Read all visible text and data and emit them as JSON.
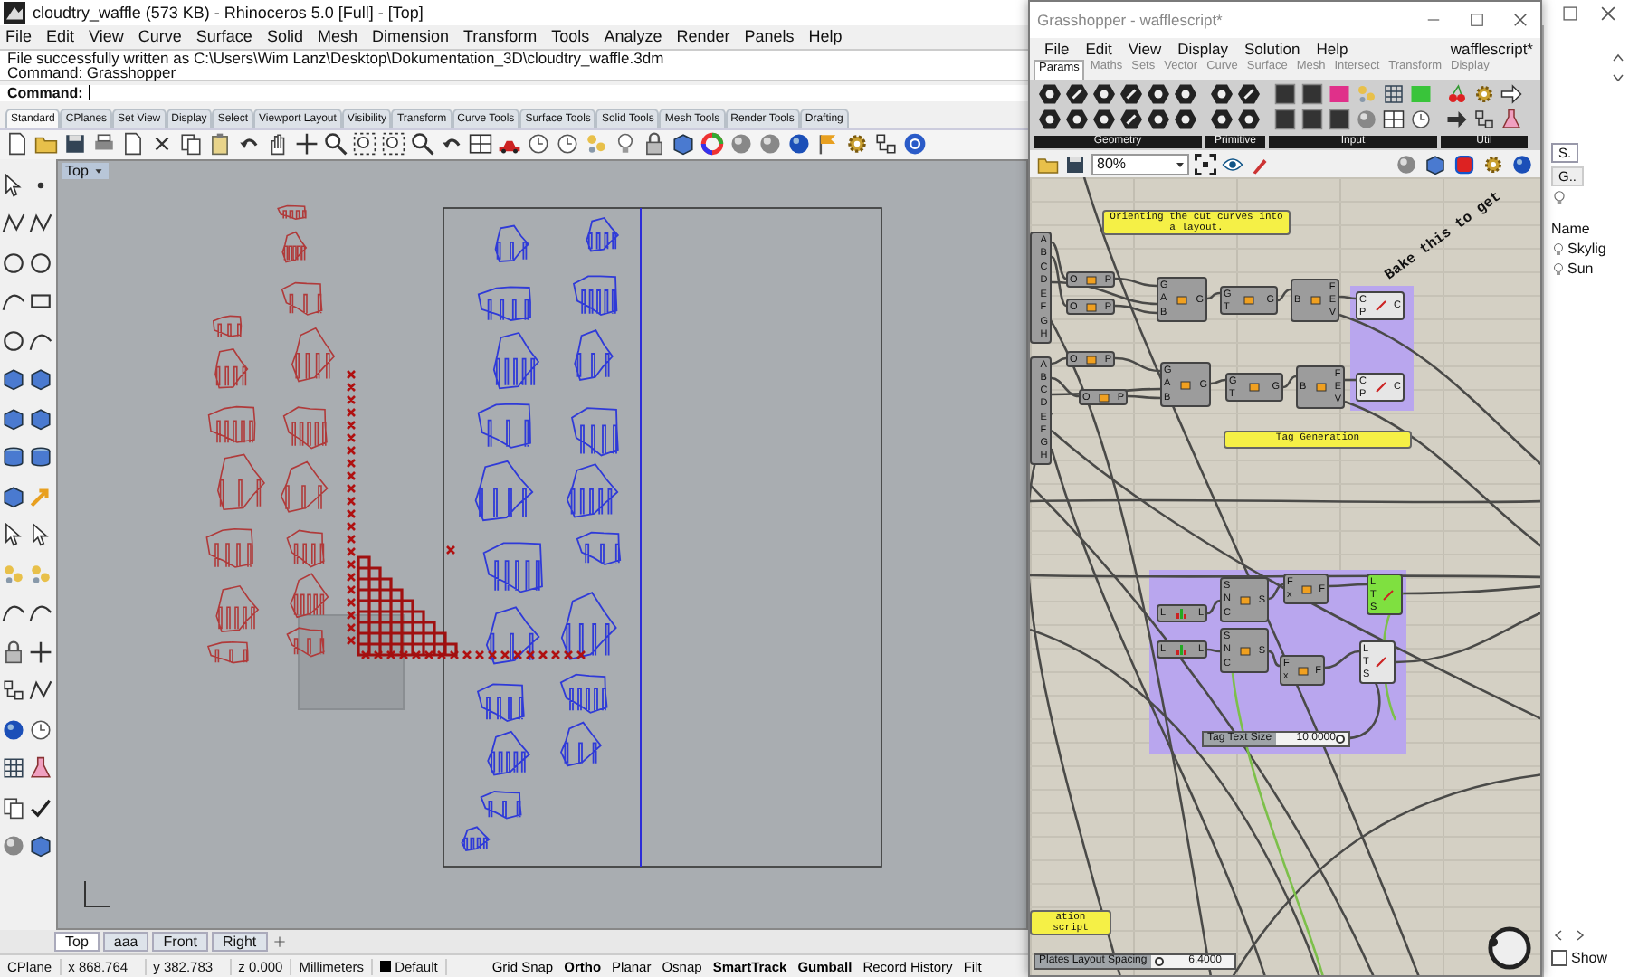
{
  "window": {
    "title": "cloudtry_waffle (573 KB) - Rhinoceros 5.0 [Full] - [Top]"
  },
  "menu": [
    "File",
    "Edit",
    "View",
    "Curve",
    "Surface",
    "Solid",
    "Mesh",
    "Dimension",
    "Transform",
    "Tools",
    "Analyze",
    "Render",
    "Panels",
    "Help"
  ],
  "command_history": [
    "File successfully written as C:\\Users\\Wim Lanz\\Desktop\\Dokumentation_3D\\cloudtry_waffle.3dm",
    "Command: Grasshopper"
  ],
  "command_prompt": "Command:",
  "toolbar_tabs": [
    {
      "label": "Standard",
      "selected": true
    },
    {
      "label": "CPlanes",
      "selected": false
    },
    {
      "label": "Set View",
      "selected": false
    },
    {
      "label": "Display",
      "selected": false
    },
    {
      "label": "Select",
      "selected": false
    },
    {
      "label": "Viewport Layout",
      "selected": false
    },
    {
      "label": "Visibility",
      "selected": false
    },
    {
      "label": "Transform",
      "selected": false
    },
    {
      "label": "Curve Tools",
      "selected": false
    },
    {
      "label": "Surface Tools",
      "selected": false
    },
    {
      "label": "Solid Tools",
      "selected": false
    },
    {
      "label": "Mesh Tools",
      "selected": false
    },
    {
      "label": "Render Tools",
      "selected": false
    },
    {
      "label": "Drafting",
      "selected": false
    }
  ],
  "viewport": {
    "label": "Top"
  },
  "viewport_tabs": [
    {
      "label": "Top",
      "selected": true
    },
    {
      "label": "aaa",
      "selected": false
    },
    {
      "label": "Front",
      "selected": false
    },
    {
      "label": "Right",
      "selected": false
    }
  ],
  "status_bar": {
    "cplane": "CPlane",
    "x": "x 868.764",
    "y": "y 382.783",
    "z": "z 0.000",
    "units": "Millimeters",
    "layer": "Default",
    "toggles": [
      {
        "label": "Grid Snap",
        "on": false
      },
      {
        "label": "Ortho",
        "on": true
      },
      {
        "label": "Planar",
        "on": false
      },
      {
        "label": "Osnap",
        "on": false
      },
      {
        "label": "SmartTrack",
        "on": true
      },
      {
        "label": "Gumball",
        "on": true
      },
      {
        "label": "Record History",
        "on": false
      },
      {
        "label": "Filt",
        "on": false
      }
    ]
  },
  "side_panel": {
    "tabs": [
      {
        "label": "S.",
        "selected": true
      },
      {
        "label": "G..",
        "selected": false
      }
    ],
    "column": "Name",
    "items": [
      "Skylig",
      "Sun"
    ],
    "show_checkbox": {
      "label": "Show",
      "checked": false
    }
  },
  "grasshopper": {
    "title": "Grasshopper - wafflescript*",
    "menu": [
      "File",
      "Edit",
      "View",
      "Display",
      "Solution",
      "Help"
    ],
    "document": "wafflescript*",
    "tabs": [
      {
        "label": "Params",
        "selected": true
      },
      {
        "label": "Maths",
        "selected": false
      },
      {
        "label": "Sets",
        "selected": false
      },
      {
        "label": "Vector",
        "selected": false
      },
      {
        "label": "Curve",
        "selected": false
      },
      {
        "label": "Surface",
        "selected": false
      },
      {
        "label": "Mesh",
        "selected": false
      },
      {
        "label": "Intersect",
        "selected": false
      },
      {
        "label": "Transform",
        "selected": false
      },
      {
        "label": "Display",
        "selected": false
      }
    ],
    "ribbon_groups": [
      "Geometry",
      "Primitive",
      "Input",
      "Util"
    ],
    "zoom": "80%",
    "canvas": {
      "panels": [
        {
          "text": "Orienting the cut curves into a layout."
        },
        {
          "text": "Tag Generation"
        },
        {
          "text": "ation script"
        }
      ],
      "note": "Bake this to get",
      "sliders": [
        {
          "label": "Tag Text Size",
          "value": "10.0000",
          "level": 0.95
        },
        {
          "label": "Plates Layout Spacing",
          "value": "6.4000",
          "level": 0.15
        }
      ],
      "nodes": [
        {
          "kind": "param",
          "outputs": [
            "A",
            "B",
            "C",
            "D",
            "E",
            "F",
            "G",
            "H"
          ],
          "selected": false
        },
        {
          "kind": "component",
          "inputs": [
            "O"
          ],
          "outputs": [
            "P"
          ],
          "selected": false
        },
        {
          "kind": "component",
          "inputs": [
            "O"
          ],
          "outputs": [
            "P"
          ],
          "selected": false
        },
        {
          "kind": "component",
          "inputs": [
            "G",
            "A",
            "B"
          ],
          "outputs": [
            "G"
          ],
          "selected": false
        },
        {
          "kind": "component",
          "inputs": [
            "G",
            "T"
          ],
          "outputs": [
            "G"
          ],
          "selected": false
        },
        {
          "kind": "component",
          "inputs": [
            "B"
          ],
          "outputs": [
            "F",
            "E",
            "V"
          ],
          "selected": false
        },
        {
          "kind": "tag",
          "inputs": [
            "C",
            "P"
          ],
          "outputs": [
            "C"
          ],
          "selected": false
        },
        {
          "kind": "param",
          "outputs": [
            "A",
            "B",
            "C",
            "D",
            "E",
            "F",
            "G",
            "H"
          ],
          "selected": false
        },
        {
          "kind": "component",
          "inputs": [
            "O"
          ],
          "outputs": [
            "P"
          ],
          "selected": false
        },
        {
          "kind": "component",
          "inputs": [
            "O"
          ],
          "outputs": [
            "P"
          ],
          "selected": false
        },
        {
          "kind": "component",
          "inputs": [
            "G",
            "A",
            "B"
          ],
          "outputs": [
            "G"
          ],
          "selected": false
        },
        {
          "kind": "component",
          "inputs": [
            "G",
            "T"
          ],
          "outputs": [
            "G"
          ],
          "selected": false
        },
        {
          "kind": "component",
          "inputs": [
            "B"
          ],
          "outputs": [
            "F",
            "E",
            "V"
          ],
          "selected": false
        },
        {
          "kind": "tag",
          "inputs": [
            "C",
            "P"
          ],
          "outputs": [
            "C"
          ],
          "selected": false
        },
        {
          "kind": "component",
          "inputs": [
            "L"
          ],
          "outputs": [
            "L"
          ],
          "selected": false
        },
        {
          "kind": "component",
          "inputs": [
            "L"
          ],
          "outputs": [
            "L"
          ],
          "selected": false
        },
        {
          "kind": "component",
          "inputs": [
            "S",
            "N",
            "C"
          ],
          "outputs": [
            "S"
          ],
          "selected": false
        },
        {
          "kind": "component",
          "inputs": [
            "S",
            "N",
            "C"
          ],
          "outputs": [
            "S"
          ],
          "selected": false
        },
        {
          "kind": "component",
          "inputs": [
            "F",
            "x"
          ],
          "outputs": [
            "F"
          ],
          "selected": false
        },
        {
          "kind": "component",
          "inputs": [
            "F",
            "x"
          ],
          "outputs": [
            "F"
          ],
          "selected": false
        },
        {
          "kind": "tag",
          "inputs": [
            "L",
            "T",
            "S"
          ],
          "selected": true
        },
        {
          "kind": "tag",
          "inputs": [
            "L",
            "T",
            "S"
          ],
          "selected": false
        }
      ]
    }
  }
}
